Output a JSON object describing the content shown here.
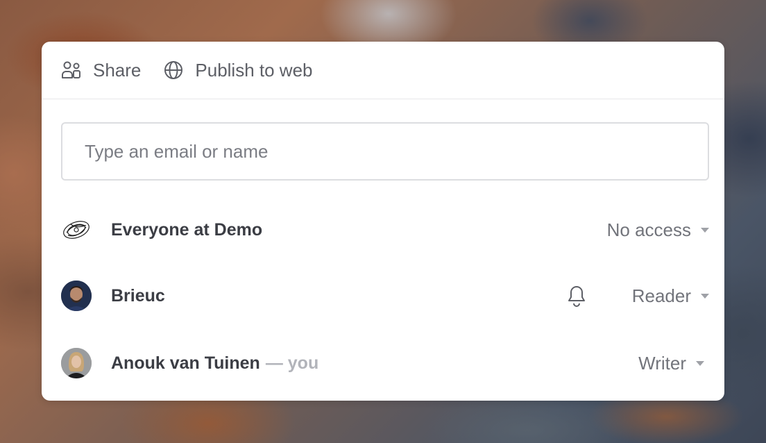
{
  "tabs": {
    "share_label": "Share",
    "publish_label": "Publish to web"
  },
  "search": {
    "placeholder": "Type an email or name",
    "value": ""
  },
  "members": [
    {
      "name": "Everyone at Demo",
      "suffix": "",
      "role": "No access",
      "notify_icon": false,
      "avatar_icon": "team-logo-icon"
    },
    {
      "name": "Brieuc",
      "suffix": "",
      "role": "Reader",
      "notify_icon": true,
      "avatar_icon": "user-avatar"
    },
    {
      "name": "Anouk van Tuinen",
      "suffix": "— you",
      "role": "Writer",
      "notify_icon": false,
      "avatar_icon": "user-avatar"
    }
  ],
  "icons": {
    "share": "people-icon",
    "publish": "globe-icon",
    "notify": "bell-icon",
    "dropdown": "caret-down-icon"
  },
  "colors": {
    "text_primary": "#3b3d44",
    "text_secondary": "#72747b",
    "muted": "#b2b4ba",
    "border": "#dcdde0"
  }
}
